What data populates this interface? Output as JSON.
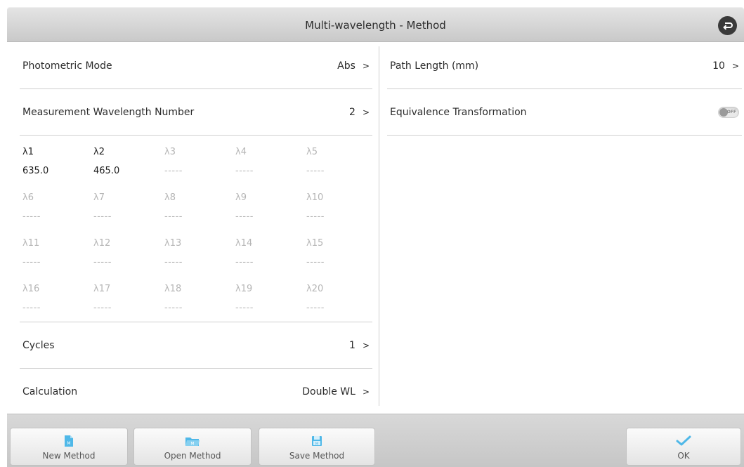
{
  "header": {
    "title": "Multi-wavelength - Method",
    "back_icon": "back-arrow-icon"
  },
  "left": {
    "photometric_mode": {
      "label": "Photometric Mode",
      "value": "Abs",
      "arrow": ">"
    },
    "wavelength_number": {
      "label": "Measurement Wavelength Number",
      "value": "2",
      "arrow": ">"
    },
    "wavelengths": [
      {
        "name": "λ1",
        "value": "635.0",
        "active": true
      },
      {
        "name": "λ2",
        "value": "465.0",
        "active": true
      },
      {
        "name": "λ3",
        "value": "-----",
        "active": false
      },
      {
        "name": "λ4",
        "value": "-----",
        "active": false
      },
      {
        "name": "λ5",
        "value": "-----",
        "active": false
      },
      {
        "name": "λ6",
        "value": "-----",
        "active": false
      },
      {
        "name": "λ7",
        "value": "-----",
        "active": false
      },
      {
        "name": "λ8",
        "value": "-----",
        "active": false
      },
      {
        "name": "λ9",
        "value": "-----",
        "active": false
      },
      {
        "name": "λ10",
        "value": "-----",
        "active": false
      },
      {
        "name": "λ11",
        "value": "-----",
        "active": false
      },
      {
        "name": "λ12",
        "value": "-----",
        "active": false
      },
      {
        "name": "λ13",
        "value": "-----",
        "active": false
      },
      {
        "name": "λ14",
        "value": "-----",
        "active": false
      },
      {
        "name": "λ15",
        "value": "-----",
        "active": false
      },
      {
        "name": "λ16",
        "value": "-----",
        "active": false
      },
      {
        "name": "λ17",
        "value": "-----",
        "active": false
      },
      {
        "name": "λ18",
        "value": "-----",
        "active": false
      },
      {
        "name": "λ19",
        "value": "-----",
        "active": false
      },
      {
        "name": "λ20",
        "value": "-----",
        "active": false
      }
    ],
    "cycles": {
      "label": "Cycles",
      "value": "1",
      "arrow": ">"
    },
    "calculation": {
      "label": "Calculation",
      "value": "Double WL",
      "arrow": ">"
    }
  },
  "right": {
    "path_length": {
      "label": "Path Length (mm)",
      "value": "10",
      "arrow": ">"
    },
    "equivalence": {
      "label": "Equivalence Transformation",
      "toggle_text": "OFF",
      "toggle_state": "off"
    }
  },
  "toolbar": {
    "new_method": {
      "label": "New Method",
      "icon": "new-file-icon"
    },
    "open_method": {
      "label": "Open Method",
      "icon": "folder-open-icon"
    },
    "save_method": {
      "label": "Save Method",
      "icon": "save-disk-icon"
    },
    "ok": {
      "label": "OK",
      "icon": "checkmark-icon"
    }
  },
  "colors": {
    "accent": "#4fb8e8",
    "active_text": "#1c1c1c",
    "inactive_text": "#b5b5b5"
  }
}
